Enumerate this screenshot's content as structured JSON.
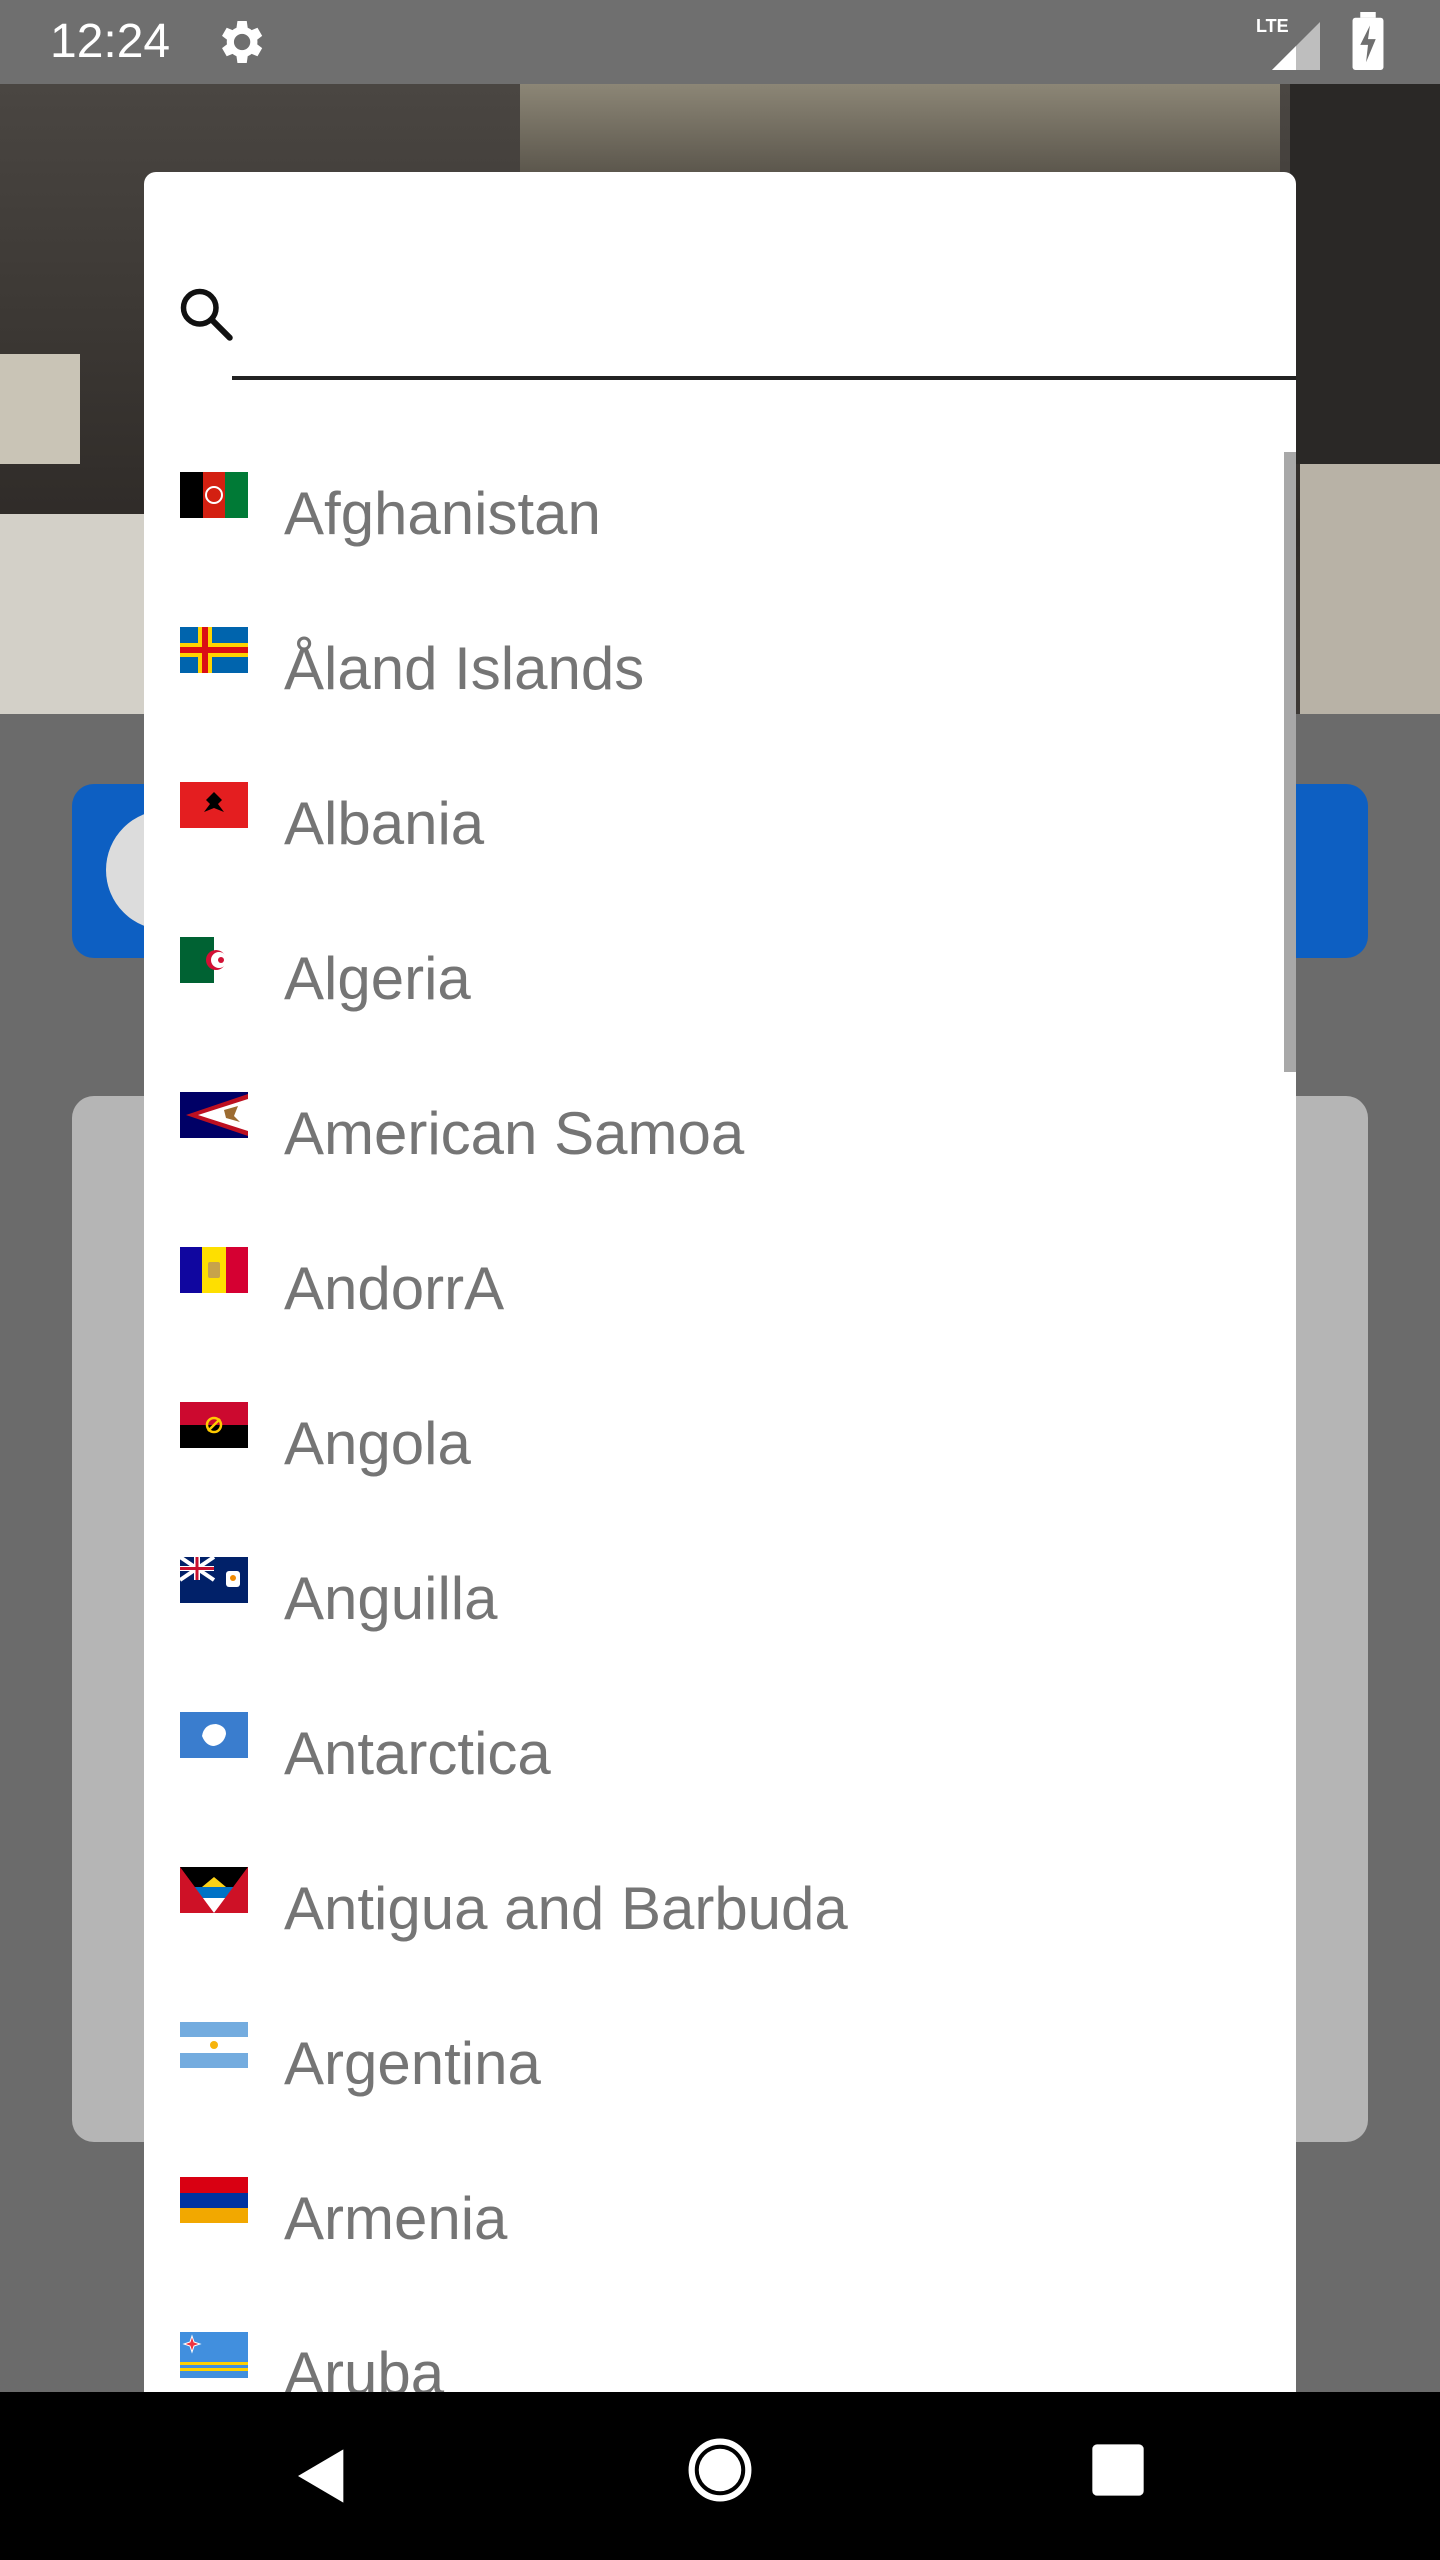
{
  "status_bar": {
    "time": "12:24",
    "network": "LTE",
    "icons": [
      "gear-icon",
      "signal-icon",
      "battery-charging-icon"
    ]
  },
  "search": {
    "value": "",
    "placeholder": ""
  },
  "countries": [
    {
      "name": "Afghanistan",
      "flag": "afghanistan-flag-icon"
    },
    {
      "name": "Åland Islands",
      "flag": "aland-islands-flag-icon"
    },
    {
      "name": "Albania",
      "flag": "albania-flag-icon"
    },
    {
      "name": "Algeria",
      "flag": "algeria-flag-icon"
    },
    {
      "name": "American Samoa",
      "flag": "american-samoa-flag-icon"
    },
    {
      "name": "AndorrA",
      "flag": "andorra-flag-icon"
    },
    {
      "name": "Angola",
      "flag": "angola-flag-icon"
    },
    {
      "name": "Anguilla",
      "flag": "anguilla-flag-icon"
    },
    {
      "name": "Antarctica",
      "flag": "antarctica-flag-icon"
    },
    {
      "name": "Antigua and Barbuda",
      "flag": "antigua-and-barbuda-flag-icon"
    },
    {
      "name": "Argentina",
      "flag": "argentina-flag-icon"
    },
    {
      "name": "Armenia",
      "flag": "armenia-flag-icon"
    },
    {
      "name": "Aruba",
      "flag": "aruba-flag-icon"
    }
  ],
  "nav_bar": {
    "icons": [
      "back-icon",
      "home-icon",
      "recent-apps-icon"
    ]
  },
  "colors": {
    "dialog_bg": "#ffffff",
    "country_text": "#757575",
    "nav_bg": "#000000",
    "status_bg": "#6f6f6f",
    "scrim": "#6b6b6b"
  }
}
